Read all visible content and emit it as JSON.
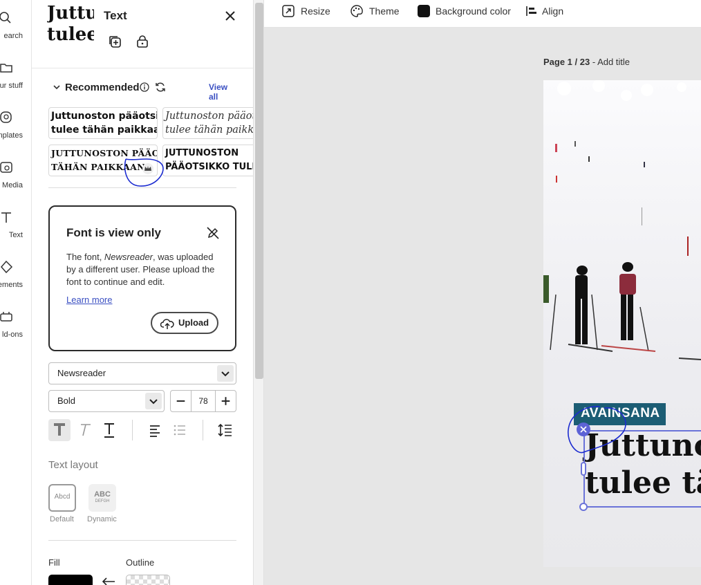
{
  "rail": {
    "items": [
      {
        "label": "earch",
        "icon": "search-icon"
      },
      {
        "label": "ur stuff",
        "icon": "folder-icon"
      },
      {
        "label": "mplates",
        "icon": "templates-icon"
      },
      {
        "label": "Media",
        "icon": "media-icon"
      },
      {
        "label": "Text",
        "icon": "text-icon"
      },
      {
        "label": "ements",
        "icon": "elements-icon"
      },
      {
        "label": "ld-ons",
        "icon": "add-ons-icon"
      }
    ]
  },
  "panel": {
    "preview_lines": [
      "Juttu",
      "tulee"
    ],
    "title": "Text",
    "recommended": {
      "title": "Recommended",
      "view_all": "View all",
      "tiles": [
        {
          "line1": "Juttunoston pääotsikko",
          "line2": "tulee tähän paikkaan"
        },
        {
          "line1": "Juttunoston pääotsikko",
          "line2": "tulee tähän paikkaan"
        },
        {
          "line1": "JUTTUNOSTON PÄÄOTSIKKO",
          "line2": "TÄHÄN PAIKKAAN"
        },
        {
          "line1": "JUTTUNOSTON",
          "line2": "PÄÄOTSIKKO TULEE"
        }
      ]
    },
    "font_notice": {
      "title": "Font is view only",
      "body_prefix": "The font, ",
      "font_name": "Newsreader",
      "body_suffix": ", was uploaded by a different user. Please upload the font to continue and edit.",
      "learn_more": "Learn more",
      "upload": "Upload"
    },
    "font_family": "Newsreader",
    "font_weight": "Bold",
    "font_size": "78",
    "text_layout": {
      "title": "Text layout",
      "options": [
        {
          "label": "Default",
          "sample": "Abcd"
        },
        {
          "label": "Dynamic",
          "sample": "ABC",
          "sample_sub": "DEFGH"
        }
      ]
    },
    "fill_label": "Fill",
    "outline_label": "Outline",
    "colors": {
      "fill": "#000000",
      "accent": "#3a4fc2"
    }
  },
  "toolbar": {
    "resize": "Resize",
    "theme": "Theme",
    "background_color": "Background color",
    "align": "Align"
  },
  "page": {
    "page_num": "Page 1 / 23",
    "sep": " - ",
    "add_title": "Add title"
  },
  "canvas": {
    "keyword": "AVAINSANA",
    "headline_line1": "Juttunoston",
    "headline_line2": "tulee tähän",
    "keyword_bg": "#1c5d74",
    "selection_color": "#6a73d9"
  }
}
